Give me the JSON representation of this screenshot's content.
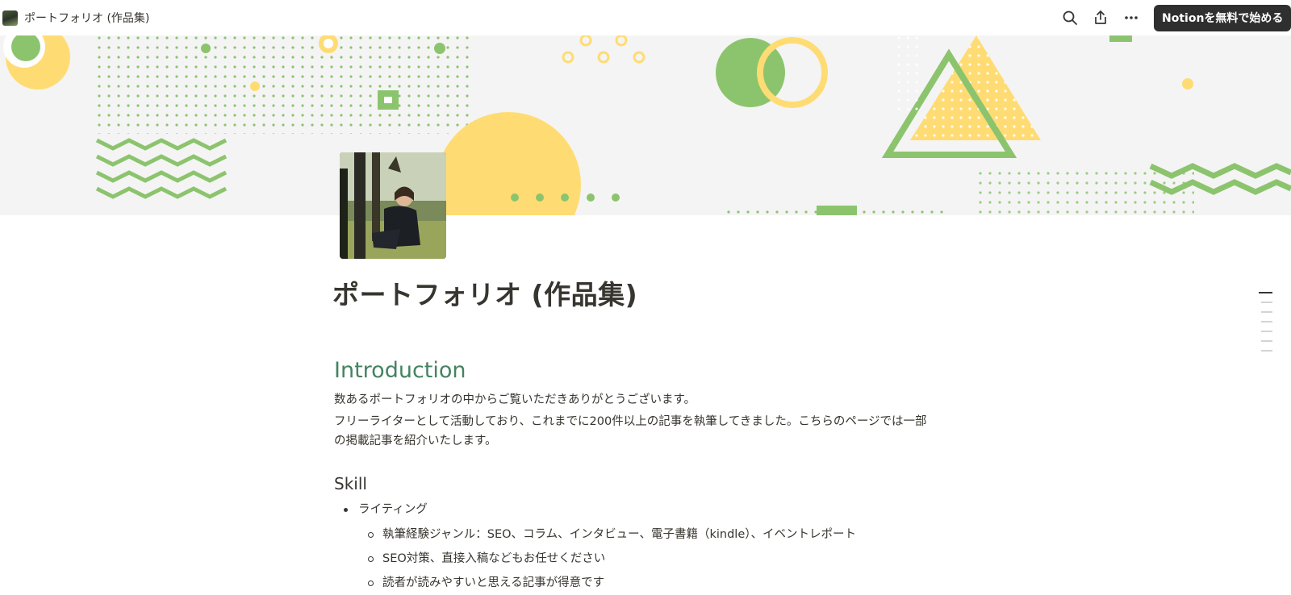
{
  "topbar": {
    "breadcrumb": "ポートフォリオ (作品集)",
    "cta_label": "Notionを無料で始める",
    "icons": [
      "search-icon",
      "share-icon",
      "more-icon"
    ]
  },
  "page": {
    "title": "ポートフォリオ (作品集)"
  },
  "intro": {
    "heading": "Introduction",
    "paragraphs": [
      "数あるポートフォリオの中からご覧いただきありがとうございます。",
      "フリーライターとして活動しており、これまでに200件以上の記事を執筆してきました。こちらのページでは一部の掲載記事を紹介いたします。"
    ]
  },
  "skill": {
    "heading": "Skill",
    "items": [
      {
        "label": "ライティング",
        "children": [
          "執筆経験ジャンル：SEO、コラム、インタビュー、電子書籍（kindle）、イベントレポート",
          "SEO対策、直接入稿などもお任せください",
          "読者が読みやすいと思える記事が得意です"
        ]
      }
    ]
  },
  "colors": {
    "accent_green": "#448361",
    "cover_green": "#8cc46e",
    "cover_yellow": "#ffdc73",
    "cover_bg": "#f4f4f4",
    "cta_bg": "#2f2f2f"
  }
}
